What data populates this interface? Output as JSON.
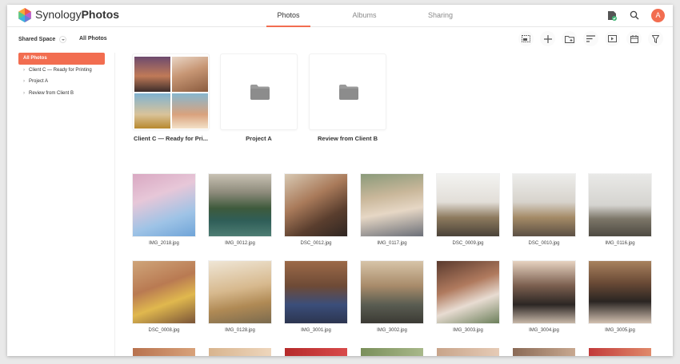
{
  "app": {
    "brand_part1": "Synology",
    "brand_part2": "Photos",
    "accent": "#f26d50"
  },
  "tabs": [
    {
      "label": "Photos",
      "active": true
    },
    {
      "label": "Albums",
      "active": false
    },
    {
      "label": "Sharing",
      "active": false
    }
  ],
  "user": {
    "avatar_letter": "A"
  },
  "subbar": {
    "space": "Shared Space",
    "view": "All Photos"
  },
  "sidebar": {
    "items": [
      {
        "label": "All Photos",
        "active": true
      },
      {
        "label": "Client C — Ready for Printing",
        "active": false
      },
      {
        "label": "Project A",
        "active": false
      },
      {
        "label": "Review from Client B",
        "active": false
      }
    ]
  },
  "folders": [
    {
      "label": "Client C — Ready for Pri..."
    },
    {
      "label": "Project A"
    },
    {
      "label": "Review from Client B"
    }
  ],
  "photos_row1": [
    {
      "name": "IMG_2018.jpg"
    },
    {
      "name": "IMG_0012.jpg"
    },
    {
      "name": "DSC_0012.jpg"
    },
    {
      "name": "IMG_0117.jpg"
    },
    {
      "name": "DSC_0009.jpg"
    },
    {
      "name": "DSC_0010.jpg"
    },
    {
      "name": "IMG_0116.jpg"
    }
  ],
  "photos_row2": [
    {
      "name": "DSC_0008.jpg"
    },
    {
      "name": "IMG_0128.jpg"
    },
    {
      "name": "IMG_3001.jpg"
    },
    {
      "name": "IMG_3002.jpg"
    },
    {
      "name": "IMG_3003.jpg"
    },
    {
      "name": "IMG_3004.jpg"
    },
    {
      "name": "IMG_3005.jpg"
    }
  ]
}
